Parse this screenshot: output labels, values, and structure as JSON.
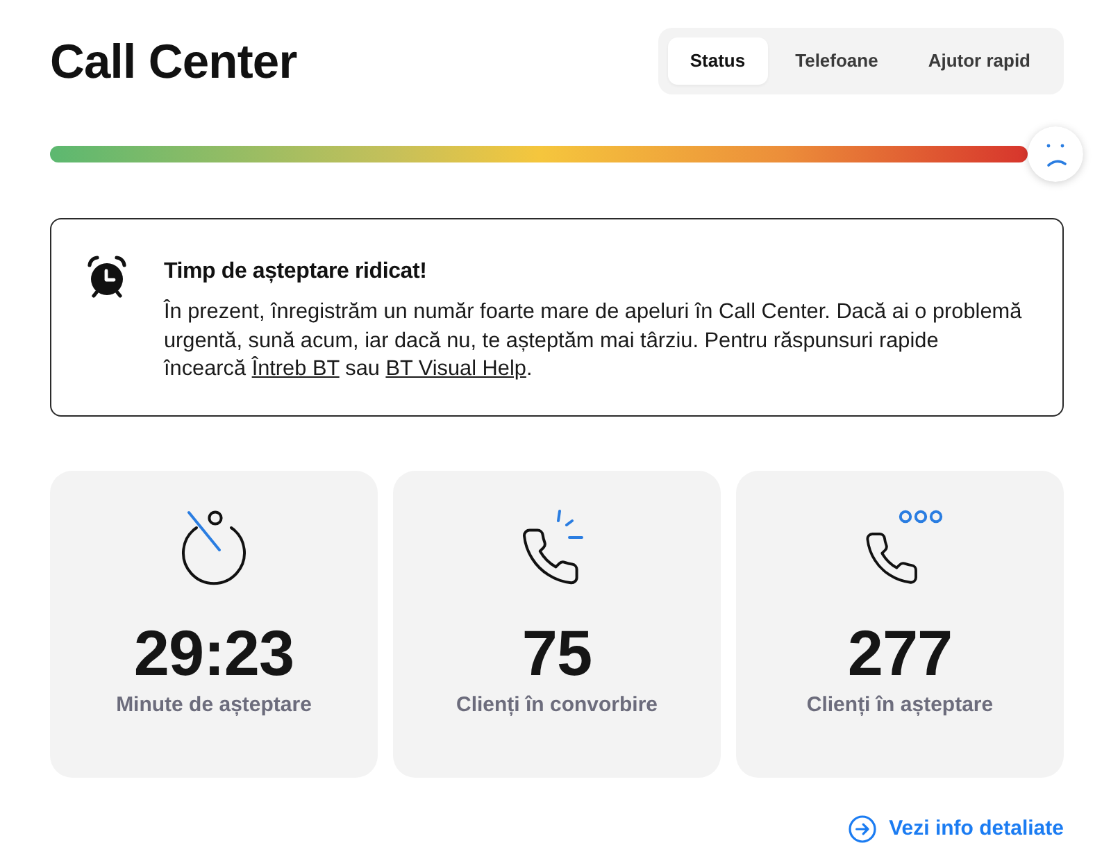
{
  "header": {
    "title": "Call Center"
  },
  "tabs": [
    {
      "label": "Status",
      "selected": true
    },
    {
      "label": "Telefoane",
      "selected": false
    },
    {
      "label": "Ajutor rapid",
      "selected": false
    }
  ],
  "meter": {
    "level": 1
  },
  "alert": {
    "title": "Timp de așteptare ridicat!",
    "message": [
      {
        "kind": "text",
        "text": "În prezent, înregistrăm un număr foarte mare de apeluri în Call Center. Dacă ai o problemă urgentă, sună acum, iar dacă nu, te așteptăm mai târziu. Pentru răspunsuri rapide încearcă "
      },
      {
        "kind": "link",
        "text": "Întreb BT"
      },
      {
        "kind": "text",
        "text": " sau "
      },
      {
        "kind": "link",
        "text": "BT Visual Help"
      },
      {
        "kind": "text",
        "text": "."
      }
    ]
  },
  "stats": [
    {
      "kind": "timer",
      "value": "29:23",
      "label": "Minute de așteptare"
    },
    {
      "kind": "call-active",
      "value": "75",
      "label": "Clienți în convorbire"
    },
    {
      "kind": "call-queue",
      "value": "277",
      "label": "Clienți în așteptare"
    }
  ],
  "details_link": {
    "label": "Vezi info detaliate"
  }
}
